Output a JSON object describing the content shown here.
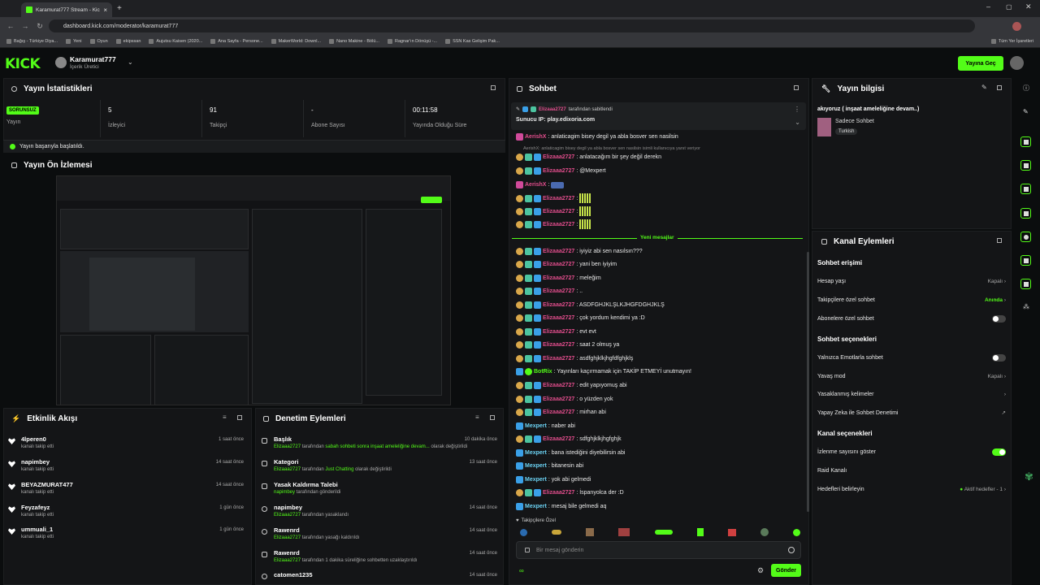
{
  "browser": {
    "tab_title": "Karamurat777 Stream - Kick Da",
    "url": "dashboard.kick.com/moderator/karamurat777",
    "bookmarks": [
      "Bağış - Türkiye Diya...",
      "Yeni",
      "Oyun",
      "ekipssan",
      "Aujutsu Kaisen (2020...",
      "Ana Sayfa - Persone...",
      "MakerWorld: Downl...",
      "Nano Makine - Bölü...",
      "Ragnar'ın Dönüşü -...",
      "SSN Kas Gelişim Pak..."
    ],
    "bookmarks_right": "Tüm Yer İşaretleri"
  },
  "header": {
    "logo": "KICK",
    "username": "Karamurat777",
    "role": "İçerik Üretici",
    "go_live": "Yayına Geç"
  },
  "stats": {
    "title": "Yayın İstatistikleri",
    "items": [
      {
        "value": "SORUNSUZ",
        "label": "Yayın"
      },
      {
        "value": "5",
        "label": "İzleyici"
      },
      {
        "value": "91",
        "label": "Takipçi"
      },
      {
        "value": "-",
        "label": "Abone Sayısı"
      },
      {
        "value": "00:11:58",
        "label": "Yayında Olduğu Süre"
      }
    ],
    "success": "Yayın başarıyla başlatıldı."
  },
  "preview": {
    "title": "Yayın Ön İzlemesi"
  },
  "activity": {
    "title": "Etkinlik Akışı",
    "items": [
      {
        "name": "4lperen0",
        "desc": "kanalı takip etti",
        "time": "1 saat önce"
      },
      {
        "name": "napimbey",
        "desc": "kanalı takip etti",
        "time": "14 saat önce"
      },
      {
        "name": "BEYAZMURAT477",
        "desc": "kanalı takip etti",
        "time": "14 saat önce"
      },
      {
        "name": "Feyzafeyz",
        "desc": "kanalı takip etti",
        "time": "1 gün önce"
      },
      {
        "name": "ummuali_1",
        "desc": "kanalı takip etti",
        "time": "1 gün önce"
      }
    ]
  },
  "moderation": {
    "title": "Denetim Eylemleri",
    "items": [
      {
        "title": "Başlık",
        "actor": "Elizaaa2727",
        "mid": " tarafından ",
        "obj": "sabah sohbeti sonra inşaat ameleliğine devam...",
        "end": " olarak değiştirildi",
        "time": "10 dakika önce"
      },
      {
        "title": "Kategori",
        "actor": "Elizaaa2727",
        "mid": " tarafından ",
        "obj": "Just Chatting",
        "end": " olarak değiştirildi",
        "time": "13 saat önce"
      },
      {
        "title": "Yasak Kaldırma Talebi",
        "actor": "napimbey",
        "mid": " tarafından gönderildi",
        "obj": "",
        "end": "",
        "time": ""
      },
      {
        "title": "napimbey",
        "actor": "Elizaaa2727",
        "mid": " tarafından yasaklandı",
        "obj": "",
        "end": "",
        "time": "14 saat önce"
      },
      {
        "title": "Rawenrd",
        "actor": "Elizaaa2727",
        "mid": " tarafından yasağı kaldırıldı",
        "obj": "",
        "end": "",
        "time": "14 saat önce"
      },
      {
        "title": "Rawenrd",
        "actor": "Elizaaa2727",
        "mid": " tarafından 1 dakika süreliğine sohbetten uzaklaştırıldı",
        "obj": "",
        "end": "",
        "time": "14 saat önce"
      },
      {
        "title": "catomen1235",
        "actor": "",
        "mid": "",
        "obj": "",
        "end": "",
        "time": "14 saat önce"
      }
    ]
  },
  "chat": {
    "title": "Sohbet",
    "pinned_by": "Elizaaa2727",
    "pinned_suffix": "tarafından sabitlendi",
    "pinned_text": "Sunucu IP: play.edixoria.com",
    "reply_note": "AerishX: anlaticagim bisey degil ya abla bosver sen nasilsin isimli kullanıcıya yanıt veriyor",
    "new_messages": "Yeni mesajlar",
    "subs_label": "Takipçilere Özel",
    "input_placeholder": "Bir mesaj gönderin",
    "send": "Gönder",
    "messages": [
      {
        "user": "AerishX",
        "color": "pink",
        "text": ": anlaticagim bisey degil ya abla bosver sen nasilsin",
        "badges": 0
      },
      {
        "user": "Elizaaa2727",
        "color": "pink",
        "text": ": anlatacağım bir şey değil derekn",
        "badges": 3
      },
      {
        "user": "Elizaaa2727",
        "color": "pink",
        "text": ": @Mexpert",
        "badges": 3
      },
      {
        "user": "AerishX",
        "color": "pink",
        "text": ":",
        "badges": 0
      },
      {
        "user": "Elizaaa2727",
        "color": "pink",
        "text": ":",
        "badges": 3
      },
      {
        "user": "Elizaaa2727",
        "color": "pink",
        "text": ":",
        "badges": 3
      },
      {
        "user": "Elizaaa2727",
        "color": "pink",
        "text": ":",
        "badges": 3
      },
      {
        "user": "Elizaaa2727",
        "color": "pink",
        "text": ": iyiyiz abi sen nasılsın???",
        "badges": 3
      },
      {
        "user": "Elizaaa2727",
        "color": "pink",
        "text": ": yani ben iyiyim",
        "badges": 3
      },
      {
        "user": "Elizaaa2727",
        "color": "pink",
        "text": ": meleğim",
        "badges": 3
      },
      {
        "user": "Elizaaa2727",
        "color": "pink",
        "text": ": ..",
        "badges": 3
      },
      {
        "user": "Elizaaa2727",
        "color": "pink",
        "text": ": ASDFGHJKLŞLKJHGFDGHJKLŞ",
        "badges": 3
      },
      {
        "user": "Elizaaa2727",
        "color": "pink",
        "text": ": çok yordum kendimi ya :D",
        "badges": 3
      },
      {
        "user": "Elizaaa2727",
        "color": "pink",
        "text": ": evt evt",
        "badges": 3
      },
      {
        "user": "Elizaaa2727",
        "color": "pink",
        "text": ": saat 2 olmuş ya",
        "badges": 3
      },
      {
        "user": "Elizaaa2727",
        "color": "pink",
        "text": ": asdfghjklkjhgfdfghjklş",
        "badges": 3
      },
      {
        "user": "BotRix",
        "color": "green",
        "text": ": Yayınları kaçırmamak için TAKİP ETMEYİ unutmayın!",
        "badges": 2
      },
      {
        "user": "Elizaaa2727",
        "color": "pink",
        "text": ": edit yapıyomuş abi",
        "badges": 3
      },
      {
        "user": "Elizaaa2727",
        "color": "pink",
        "text": ": o yüzden yok",
        "badges": 3
      },
      {
        "user": "Elizaaa2727",
        "color": "pink",
        "text": ": mirhan abi",
        "badges": 3
      },
      {
        "user": "Mexpert",
        "color": "cyan",
        "text": ": naber abi",
        "badges": 1
      },
      {
        "user": "Elizaaa2727",
        "color": "pink",
        "text": ": sdfghjklkjhgfghjk",
        "badges": 3
      },
      {
        "user": "Mexpert",
        "color": "cyan",
        "text": ": bana istediğini diyebilirsin abi",
        "badges": 1
      },
      {
        "user": "Mexpert",
        "color": "cyan",
        "text": ": bitanesin abi",
        "badges": 1
      },
      {
        "user": "Mexpert",
        "color": "cyan",
        "text": ": yok abi gelmedi",
        "badges": 1
      },
      {
        "user": "Elizaaa2727",
        "color": "pink",
        "text": ": İspanyolca der :D",
        "badges": 3
      },
      {
        "user": "Mexpert",
        "color": "cyan",
        "text": ": mesaj bile gelmedi aq",
        "badges": 1
      }
    ]
  },
  "stream_info": {
    "title": "Yayın bilgisi",
    "stream_title": "akıyoruz ( inşaat ameleliğine devam..)",
    "category": "Sadece Sohbet",
    "language": "Turkish"
  },
  "channel_actions": {
    "title": "Kanal Eylemleri",
    "chat_access": "Sohbet erişimi",
    "account_age": "Hesap yaşı",
    "account_age_val": "Kapalı",
    "followers_only": "Takipçilere özel sohbet",
    "followers_only_val": "Anında",
    "subs_only": "Abonelere özel sohbet",
    "chat_options": "Sohbet seçenekleri",
    "emotes_only": "Yalnızca Emotlarla sohbet",
    "slow_mode": "Yavaş mod",
    "slow_mode_val": "Kapalı",
    "banned_words": "Yasaklanmış kelimeler",
    "ai_mod": "Yapay Zeka ile Sohbet Denetimi",
    "channel_options": "Kanal seçenekleri",
    "show_viewers": "İzlenme sayısını göster",
    "raid": "Raid Kanalı",
    "goals": "Hedefleri belirleyin",
    "goals_val": "Aktif hedefler - 1"
  }
}
